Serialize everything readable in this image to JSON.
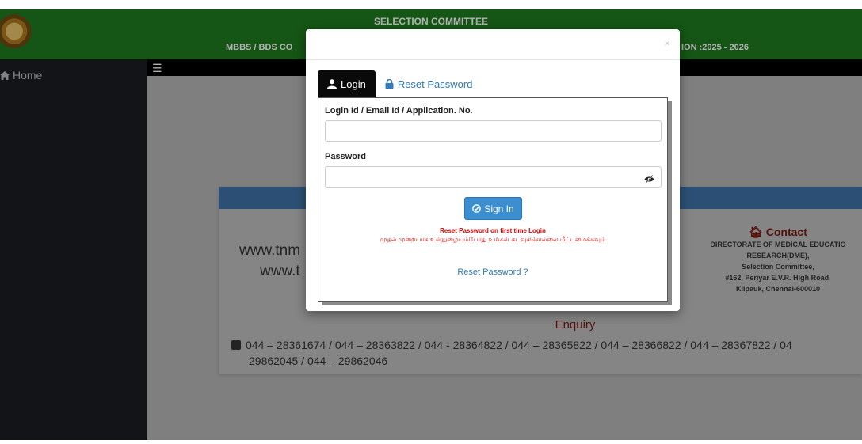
{
  "header": {
    "title": "SELECTION COMMITTEE",
    "subtitle_left": "MBBS / BDS CO",
    "subtitle_right": "ION :2025 - 2026"
  },
  "sidebar": {
    "items": [
      {
        "label": "Home",
        "icon": "home-icon"
      }
    ]
  },
  "topbar": {
    "menu_icon": "hamburger-icon"
  },
  "card": {
    "website1": "www.tnm",
    "website2": "www.t",
    "contact": {
      "title": "Contact",
      "lines": [
        "DIRECTORATE OF MEDICAL EDUCATIO",
        "RESEARCH(DME),",
        "Selection Committee,",
        "#162, Periyar E.V.R. High Road,",
        "Kilpauk, Chennai-600010"
      ]
    },
    "enquiry_title": "Enquiry",
    "phones": "044 – 28361674 / 044 – 28363822 / 044 - 28364822 / 044 – 28365822 / 044 – 28366822 / 044 – 28367822 / 04",
    "phones_line2": "29862045 / 044 – 29862046"
  },
  "modal": {
    "close_glyph": "×",
    "tabs": [
      {
        "label": "Login",
        "icon": "user-icon",
        "active": true
      },
      {
        "label": "Reset Password",
        "icon": "lock-icon",
        "active": false
      }
    ],
    "login_field": {
      "label": "Login Id / Email Id / Application. No.",
      "value": "",
      "placeholder": ""
    },
    "password_field": {
      "label": "Password",
      "value": "",
      "placeholder": "",
      "toggle_icon": "eye-slash-icon"
    },
    "signin_label": "Sign In",
    "note_en": "Reset Password on first time Login",
    "note_ta": "முதல் முறையாக உள்நுழையும்போது உங்கள் கடவுச்சொல்லை மீட்டமைக்கவும்",
    "reset_link": "Reset Password ?"
  },
  "colors": {
    "header_green": "#1f7a1f",
    "sidebar_dark": "#1a1d22",
    "card_bar_blue": "#3f73a8",
    "button_blue": "#3b8fd0",
    "link_blue": "#337ab7",
    "note_red": "#d40000",
    "contact_maroon": "#7a1a12"
  }
}
